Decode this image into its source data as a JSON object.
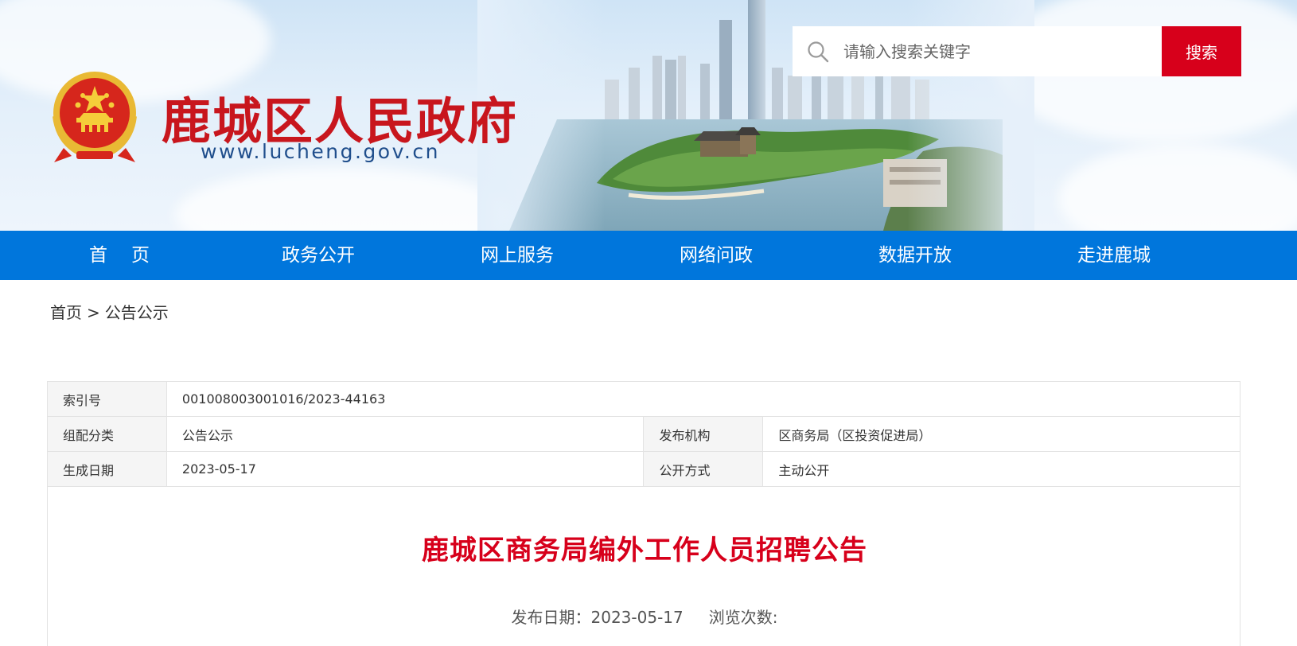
{
  "header": {
    "site_title": "鹿城区人民政府",
    "site_url": "www.lucheng.gov.cn",
    "emblem": "national-emblem"
  },
  "search": {
    "placeholder": "请输入搜索关键字",
    "button_label": "搜索",
    "icon": "search-icon"
  },
  "nav": {
    "items": [
      {
        "label": "首页"
      },
      {
        "label": "政务公开"
      },
      {
        "label": "网上服务"
      },
      {
        "label": "网络问政"
      },
      {
        "label": "数据开放"
      },
      {
        "label": "走进鹿城"
      }
    ]
  },
  "breadcrumb": {
    "home": "首页",
    "separator": ">",
    "current": "公告公示"
  },
  "info": {
    "index_label": "索引号",
    "index_value": "001008003001016/2023-44163",
    "category_label": "组配分类",
    "category_value": "公告公示",
    "publisher_label": "发布机构",
    "publisher_value": "区商务局（区投资促进局）",
    "date_label": "生成日期",
    "date_value": "2023-05-17",
    "disclosure_label": "公开方式",
    "disclosure_value": "主动公开"
  },
  "article": {
    "title": "鹿城区商务局编外工作人员招聘公告",
    "publish_date_label": "发布日期：",
    "publish_date": "2023-05-17",
    "views_label": "浏览次数:"
  },
  "colors": {
    "brand_red": "#d7001b",
    "nav_blue": "#0076dc",
    "title_red": "#c8161d"
  }
}
